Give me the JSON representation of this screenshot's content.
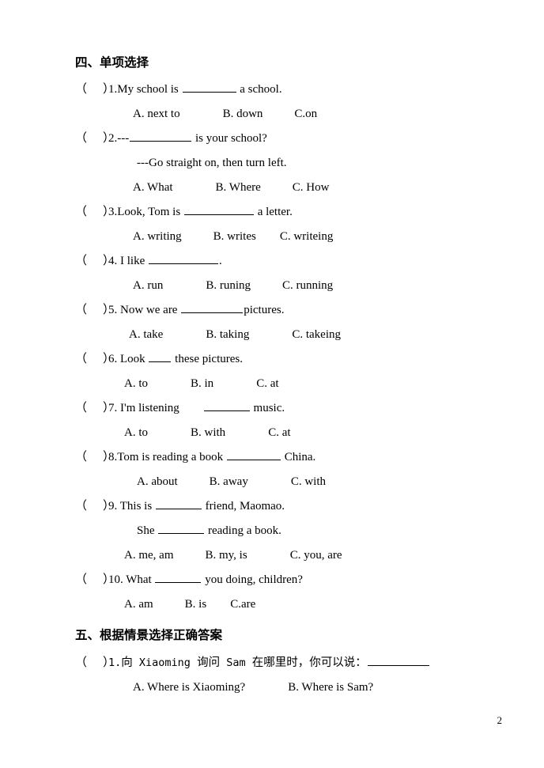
{
  "document": {
    "page_number": "2"
  },
  "sections": [
    {
      "heading": "四、单项选择",
      "questions": [
        {
          "bracket_open": "（",
          "bracket_close": "）",
          "number": "1.",
          "stem_before": "My school is",
          "stem_after": "a school.",
          "options": [
            "A. next to",
            "B. down",
            "C.on"
          ]
        },
        {
          "bracket_open": "（",
          "bracket_close": "）",
          "number": "2.",
          "stem_before": "---",
          "stem_after": "is your school?",
          "sub_line": "---Go straight on, then turn left.",
          "options": [
            "A. What",
            "B. Where",
            "C. How"
          ]
        },
        {
          "bracket_open": "（",
          "bracket_close": "）",
          "number": "3.",
          "stem_before": "Look, Tom is",
          "stem_after": "a letter.",
          "options": [
            "A. writing",
            "B. writes",
            "C. writeing"
          ]
        },
        {
          "bracket_open": "（",
          "bracket_close": "）",
          "number": "4.",
          "stem_before": "I like",
          "stem_after": ".",
          "options": [
            "A. run",
            "B. runing",
            "C. running"
          ]
        },
        {
          "bracket_open": "（",
          "bracket_close": "）",
          "number": "5.",
          "stem_before": "Now we are",
          "stem_after": "pictures.",
          "options": [
            "A. take",
            "B. taking",
            "C. takeing"
          ]
        },
        {
          "bracket_open": "（",
          "bracket_close": "）",
          "number": "6.",
          "stem_before": "Look",
          "stem_after": "these pictures.",
          "options": [
            "A. to",
            "B. in",
            "C. at"
          ]
        },
        {
          "bracket_open": "（",
          "bracket_close": "）",
          "number": "7.",
          "stem_before": "I'm listening",
          "stem_after": "music.",
          "options": [
            "A. to",
            "B. with",
            "C. at"
          ]
        },
        {
          "bracket_open": "（",
          "bracket_close": "）",
          "number": "8.",
          "stem_before": "Tom is reading a book",
          "stem_after": "China.",
          "options": [
            "A. about",
            "B. away",
            "C. with"
          ]
        },
        {
          "bracket_open": "（",
          "bracket_close": "）",
          "number": "9.",
          "stem_before": "This is",
          "stem_after": "friend, Maomao.",
          "sub_before": "She",
          "sub_after": "reading a book.",
          "options": [
            "A. me, am",
            "B. my, is",
            "C. you, are"
          ]
        },
        {
          "bracket_open": "（",
          "bracket_close": "）",
          "number": "10.",
          "stem_before": "What",
          "stem_after": "you doing, children?",
          "options": [
            "A. am",
            "B. is",
            "C.are"
          ]
        }
      ]
    },
    {
      "heading": "五、根据情景选择正确答案",
      "questions": [
        {
          "bracket_open": "（",
          "bracket_close": "）",
          "number": "1.",
          "cjk_1": "向",
          "latin_1": "Xiaoming",
          "cjk_2": "询问",
          "latin_2": "Sam",
          "cjk_3": "在哪里时，你可以说：",
          "options": [
            "A. Where is Xiaoming?",
            "B. Where is Sam?"
          ]
        }
      ]
    }
  ]
}
